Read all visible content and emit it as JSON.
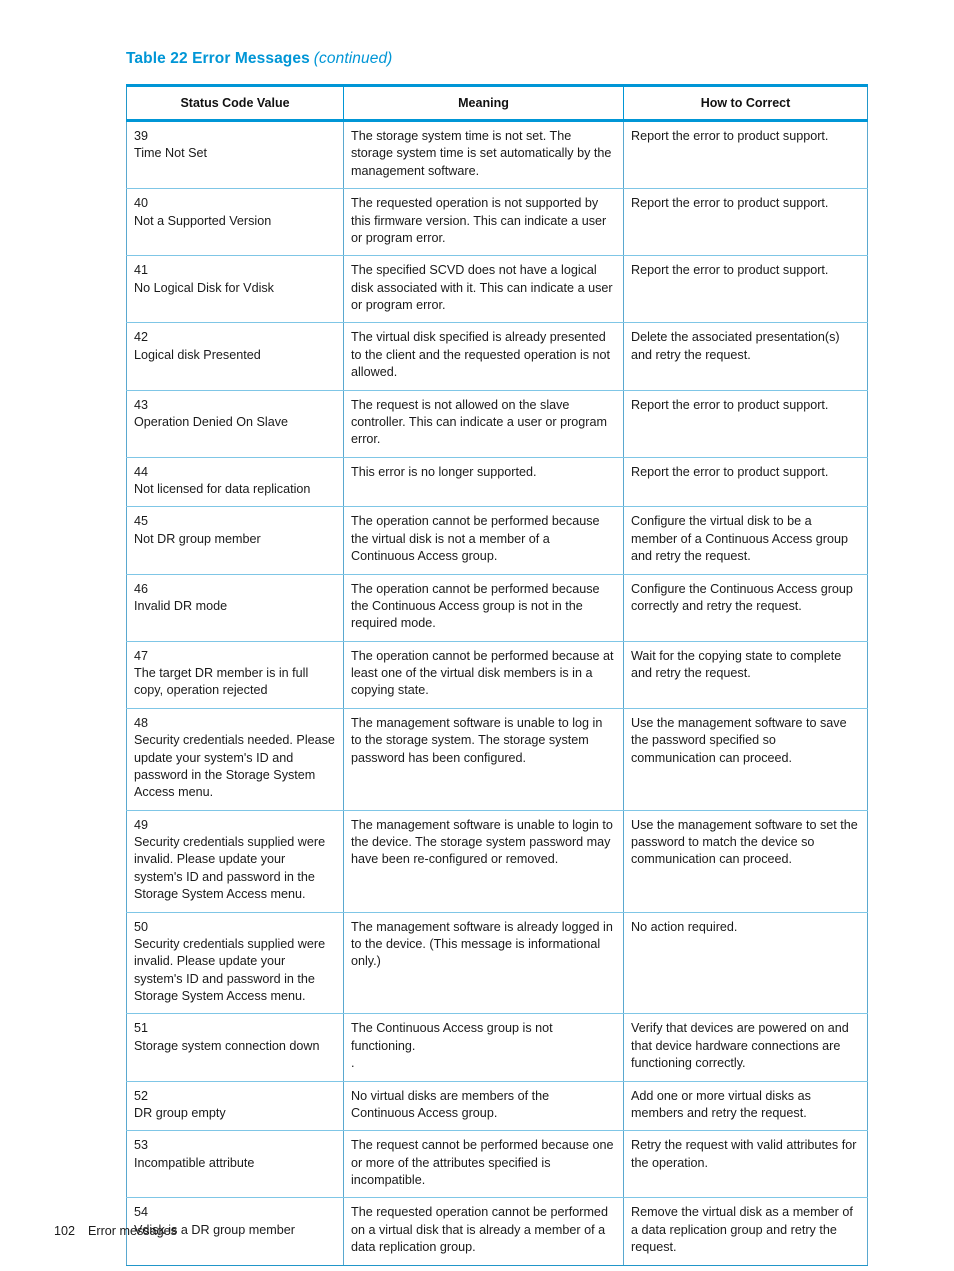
{
  "caption": {
    "title": "Table 22 Error Messages",
    "continued": "(continued)"
  },
  "table": {
    "headers": [
      "Status Code Value",
      "Meaning",
      "How to Correct"
    ],
    "rows": [
      {
        "code": "39",
        "name": "Time Not Set",
        "meaning": "The storage system time is not set. The storage system time is set automatically by the management software.",
        "correct": "Report the error to product support."
      },
      {
        "code": "40",
        "name": "Not a Supported Version",
        "meaning": "The requested operation is not supported by this firmware version. This can indicate a user or program error.",
        "correct": "Report the error to product support."
      },
      {
        "code": "41",
        "name": "No Logical Disk for Vdisk",
        "meaning": "The specified SCVD does not have a logical disk associated with it. This can indicate a user or program error.",
        "correct": "Report the error to product support."
      },
      {
        "code": "42",
        "name": "Logical disk Presented",
        "meaning": "The virtual disk specified is already presented to the client and the requested operation is not allowed.",
        "correct": "Delete the associated presentation(s) and retry the request."
      },
      {
        "code": "43",
        "name": "Operation Denied On Slave",
        "meaning": "The request is not allowed on the slave controller. This can indicate a user or program error.",
        "correct": "Report the error to product support."
      },
      {
        "code": "44",
        "name": "Not licensed for data replication",
        "meaning": "This error is no longer supported.",
        "correct": "Report the error to product support."
      },
      {
        "code": "45",
        "name": "Not DR group member",
        "meaning": "The operation cannot be performed because the virtual disk is not a member of a Continuous Access group.",
        "correct": "Configure the virtual disk to be a member of a Continuous Access group and retry the request."
      },
      {
        "code": "46",
        "name": "Invalid DR mode",
        "meaning": "The operation cannot be performed because the Continuous Access group is not in the required mode.",
        "correct": "Configure the Continuous Access group correctly and retry the request."
      },
      {
        "code": "47",
        "name": "The target DR member is in full copy, operation rejected",
        "meaning": "The operation cannot be performed because at least one of the virtual disk members is in a copying state.",
        "correct": "Wait for the copying state to complete and retry the request."
      },
      {
        "code": "48",
        "name": "Security credentials needed. Please update your system's ID and password in the Storage System Access menu.",
        "meaning": "The management software is unable to log in to the storage system. The storage system password has been configured.",
        "correct": "Use the management software to save the password specified so communication can proceed."
      },
      {
        "code": "49",
        "name": "Security credentials supplied were invalid. Please update your system's ID and password in the Storage System Access menu.",
        "meaning": "The management software is unable to login to the device. The storage system password may have been re-configured or removed.",
        "correct": "Use the management software to set the password to match the device so communication can proceed."
      },
      {
        "code": "50",
        "name": "Security credentials supplied were invalid. Please update your system's ID and password in the Storage System Access menu.",
        "meaning": "The management software is already logged in to the device. (This message is informational only.)",
        "correct": "No action required."
      },
      {
        "code": "51",
        "name": "Storage system connection down",
        "meaning": "The Continuous Access group is not functioning.\n.",
        "correct": "Verify that devices are powered on and that device hardware connections are functioning correctly."
      },
      {
        "code": "52",
        "name": "DR group empty",
        "meaning": "No virtual disks are members of the Continuous Access group.",
        "correct": "Add one or more virtual disks as members and retry the request."
      },
      {
        "code": "53",
        "name": "Incompatible attribute",
        "meaning": "The request cannot be performed because one or more of the attributes specified is incompatible.",
        "correct": "Retry the request with valid attributes for the operation."
      },
      {
        "code": "54",
        "name": "Vdisk is a DR group member",
        "meaning": "The requested operation cannot be performed on a virtual disk that is already a member of a data replication group.",
        "correct": "Remove the virtual disk as a member of a data replication group and retry the request."
      }
    ]
  },
  "footer": {
    "page_number": "102",
    "section": "Error messages"
  },
  "colors": {
    "accent_blue": "#0096d6",
    "rule_light_blue": "#7fc6e6",
    "text": "#1a1a1a"
  }
}
